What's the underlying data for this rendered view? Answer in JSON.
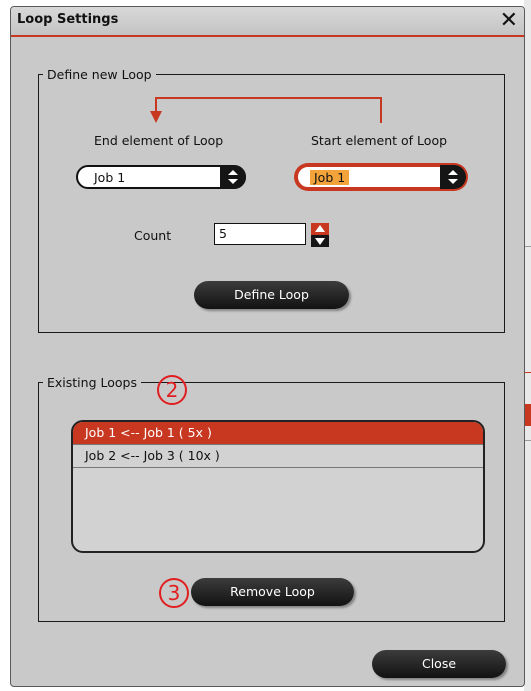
{
  "dialog": {
    "title": "Loop Settings",
    "close_icon": "close-icon"
  },
  "define_group": {
    "legend": "Define new Loop",
    "end_label": "End element of Loop",
    "start_label": "Start element of Loop",
    "end_select_value": "Job 1",
    "start_select_value": "Job 1",
    "count_label": "Count",
    "count_value": "5",
    "define_button": "Define Loop"
  },
  "existing_group": {
    "legend": "Existing Loops",
    "items": [
      "Job 1 <-- Job 1 ( 5x )",
      "Job 2 <-- Job 3 ( 10x )"
    ],
    "selected_index": 0,
    "remove_button": "Remove Loop"
  },
  "callouts": {
    "c2": "2",
    "c3": "3"
  },
  "footer": {
    "close_button": "Close"
  },
  "colors": {
    "accent": "#c83820",
    "highlight": "#f2a33a",
    "panel": "#c9c9c9",
    "button": "#151515"
  }
}
